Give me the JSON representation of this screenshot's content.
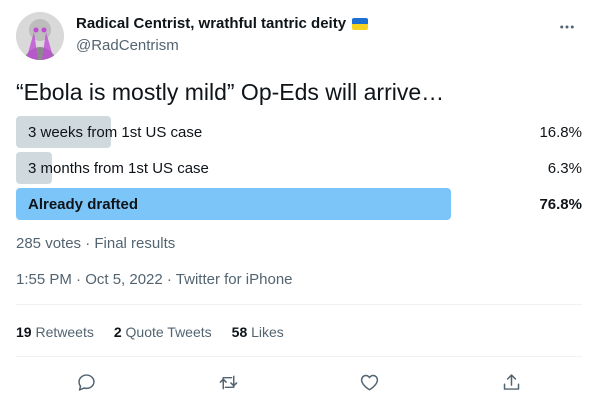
{
  "author": {
    "display_name": "Radical Centrist, wrathful tantric deity",
    "handle": "@RadCentrism",
    "flag_icon": "ukraine-flag-icon"
  },
  "tweet": {
    "text": "“Ebola is mostly mild” Op-Eds will arrive…"
  },
  "poll": {
    "options": [
      {
        "label": "3 weeks from 1st US case",
        "percent": "16.8%",
        "fraction": 0.168,
        "winner": false
      },
      {
        "label": "3 months from 1st US case",
        "percent": "6.3%",
        "fraction": 0.063,
        "winner": false
      },
      {
        "label": "Already drafted",
        "percent": "76.8%",
        "fraction": 0.768,
        "winner": true
      }
    ],
    "meta": "285 votes · Final results",
    "colors": {
      "bar": "#cfd9de",
      "winner_bar": "#7cc5f8"
    }
  },
  "timestamp": "1:55 PM · Oct 5, 2022 · Twitter for iPhone",
  "stats": {
    "retweets_num": "19",
    "retweets_label": "Retweets",
    "quotes_num": "2",
    "quotes_label": "Quote Tweets",
    "likes_num": "58",
    "likes_label": "Likes"
  },
  "actions": [
    "reply-icon",
    "retweet-icon",
    "like-icon",
    "share-icon"
  ]
}
